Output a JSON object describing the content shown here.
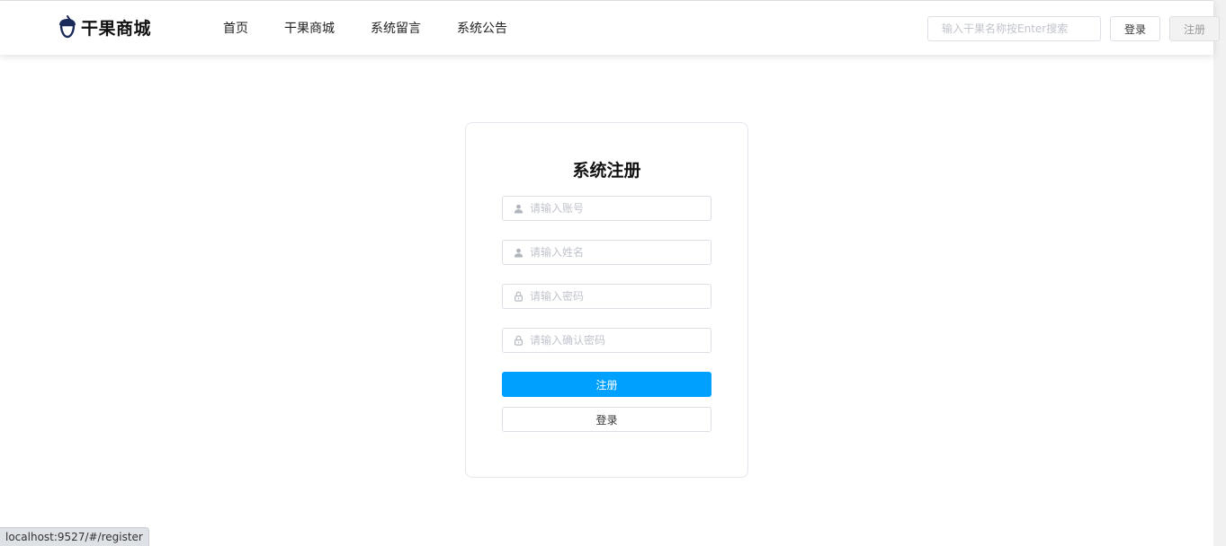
{
  "header": {
    "logo_text": "干果商城",
    "nav": [
      "首页",
      "干果商城",
      "系统留言",
      "系统公告"
    ],
    "search_placeholder": "输入干果名称按Enter搜索",
    "login_label": "登录",
    "register_label": "注册"
  },
  "form": {
    "title": "系统注册",
    "fields": [
      {
        "placeholder": "请输入账号",
        "icon": "user-icon"
      },
      {
        "placeholder": "请输入姓名",
        "icon": "user-icon"
      },
      {
        "placeholder": "请输入密码",
        "icon": "lock-icon"
      },
      {
        "placeholder": "请输入确认密码",
        "icon": "lock-icon"
      }
    ],
    "register_button": "注册",
    "login_button": "登录"
  },
  "status_url": "localhost:9527/#/register",
  "colors": {
    "primary": "#00a0ff",
    "logo_dark": "#1a2a5a"
  }
}
